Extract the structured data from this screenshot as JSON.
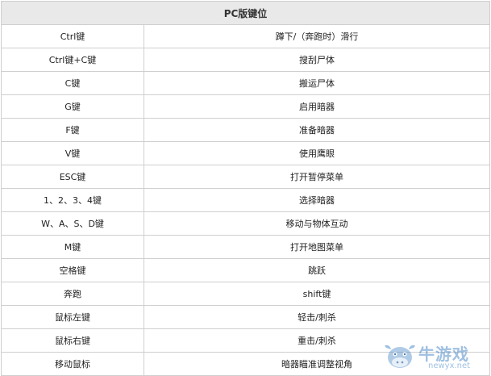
{
  "table": {
    "header": "PC版键位",
    "rows": [
      {
        "key": "Ctrl键",
        "action": "蹲下/（奔跑时）滑行"
      },
      {
        "key": "Ctrl键+C键",
        "action": "搜刮尸体"
      },
      {
        "key": "C键",
        "action": "搬运尸体"
      },
      {
        "key": "G键",
        "action": "启用暗器"
      },
      {
        "key": "F键",
        "action": "准备暗器"
      },
      {
        "key": "V键",
        "action": "使用鹰眼"
      },
      {
        "key": "ESC键",
        "action": "打开暂停菜单"
      },
      {
        "key": "1、2、3、4键",
        "action": "选择暗器"
      },
      {
        "key": "W、A、S、D键",
        "action": "移动与物体互动"
      },
      {
        "key": "M键",
        "action": "打开地图菜单"
      },
      {
        "key": "空格键",
        "action": "跳跃"
      },
      {
        "key": "奔跑",
        "action": "shift键"
      },
      {
        "key": "鼠标左键",
        "action": "轻击/刺杀"
      },
      {
        "key": "鼠标右键",
        "action": "重击/刺杀"
      },
      {
        "key": "移动鼠标",
        "action": "暗器瞄准调整视角"
      }
    ]
  },
  "watermark": {
    "text": "牛游戏",
    "url": "newyx.net"
  }
}
